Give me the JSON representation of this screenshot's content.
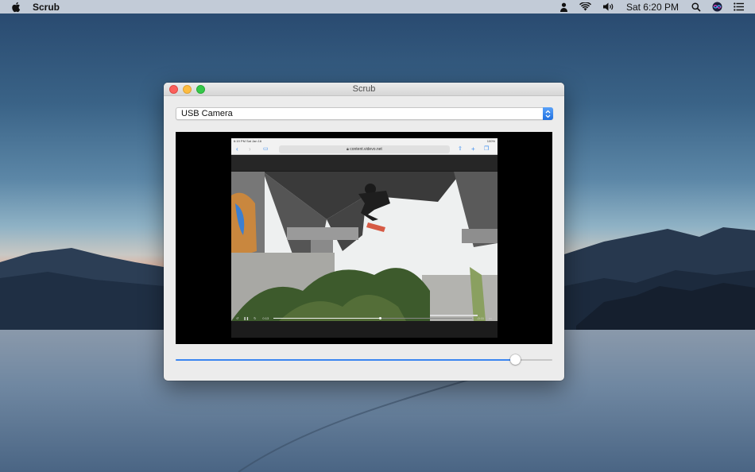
{
  "menubar": {
    "apple_icon": "apple-icon",
    "app_name": "Scrub",
    "clock": "Sat 6:20 PM",
    "icons": [
      "user-icon",
      "wifi-icon",
      "volume-icon",
      "search-icon",
      "siri-icon",
      "notification-center-icon"
    ]
  },
  "window": {
    "title": "Scrub",
    "camera_select": {
      "value": "USB Camera"
    },
    "preview": {
      "ipad_status_time": "6:19 PM  Sat Jan 16",
      "ipad_status_battery": "100%",
      "url": "content.videvo.net",
      "video_time_left": "0:13",
      "video_time_right": "-0:11"
    },
    "scrub_position": 0.9
  },
  "colors": {
    "accent": "#3b86f0",
    "close": "#fc605c",
    "minimize": "#fdbc40",
    "maximize": "#34c84a"
  }
}
